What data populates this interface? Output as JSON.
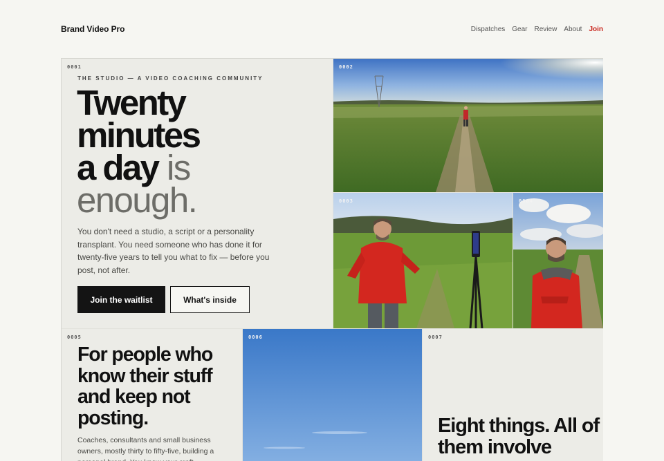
{
  "header": {
    "brand": "Brand Video Pro",
    "nav": [
      "Dispatches",
      "Gear",
      "Review",
      "About",
      "Join"
    ]
  },
  "tiles": {
    "t1": {
      "number": "0001",
      "eyebrow": "THE STUDIO — A VIDEO COACHING COMMUNITY",
      "title_line1": "Twenty",
      "title_line2": "minutes",
      "title_line3_a": "a day",
      "title_line3_b": " is",
      "title_line4": "enough.",
      "body": "You don't need a studio, a script or a personality transplant. You need someone who has done it for twenty-five years to tell you what to fix — before you post, not after.",
      "cta_primary": "Join the waitlist",
      "cta_secondary": "What's inside"
    },
    "t2": {
      "number": "0002"
    },
    "t3": {
      "number": "0003"
    },
    "t4": {
      "number": "0004"
    },
    "t5": {
      "number": "0005",
      "title": "For people who know their stuff and keep not posting.",
      "body": "Coaches, consultants and small business owners, mostly thirty to fifty-five, building a personal brand. You know your craft — getting"
    },
    "t6": {
      "number": "0006"
    },
    "t7": {
      "number": "0007",
      "title": "Eight things. All of them involve"
    }
  },
  "colors": {
    "accent": "#c8221a",
    "ink": "#141414",
    "paper": "#f6f6f2"
  }
}
